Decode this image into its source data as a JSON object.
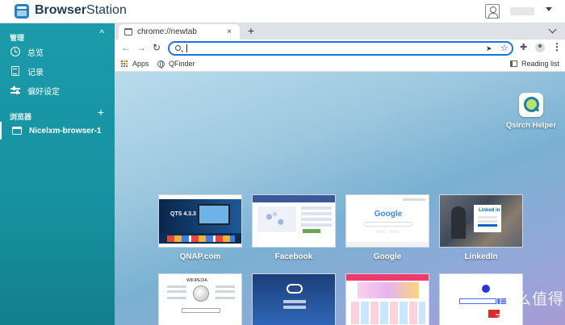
{
  "app": {
    "title_bold": "Browser",
    "title_thin": "Station"
  },
  "sidebar": {
    "manage_label": "管理",
    "manage_toggle": "^",
    "items": [
      {
        "label": "总览",
        "icon": "clock-icon"
      },
      {
        "label": "记录",
        "icon": "document-icon"
      },
      {
        "label": "偏好设定",
        "icon": "sliders-icon"
      }
    ],
    "browsers_label": "浏览器",
    "browsers_add": "+",
    "browsers": [
      {
        "label": "Nicelxm-browser-1",
        "icon": "window-icon",
        "active": true
      }
    ]
  },
  "browser": {
    "tab": {
      "title": "chrome://newtab",
      "close": "×"
    },
    "new_tab": "+",
    "address": {
      "value": "",
      "placeholder": ""
    },
    "bookmarks": [
      {
        "label": "Apps",
        "icon": "apps-grid-icon"
      },
      {
        "label": "QFinder",
        "icon": "globe-icon"
      }
    ],
    "reading_list": "Reading list"
  },
  "ntp": {
    "shortcut": {
      "label": "Qsirch Helper",
      "icon": "qsirch-icon"
    },
    "tiles_row1": [
      {
        "label": "QNAP.com",
        "thumb_text": "QTS 4.3.3"
      },
      {
        "label": "Facebook"
      },
      {
        "label": "Google",
        "thumb_text": "Google"
      },
      {
        "label": "LinkedIn",
        "thumb_text": "Linked in"
      }
    ],
    "tiles_row2": [
      {
        "thumb_text": "WIKIPEDIA"
      },
      {
        "label": ""
      },
      {
        "label": ""
      },
      {
        "label": ""
      }
    ]
  },
  "watermark": "值 么值得买",
  "colors": {
    "sidebar": "#1c9bab",
    "accent": "#1a73e8",
    "brand": "#2a7fbd"
  }
}
